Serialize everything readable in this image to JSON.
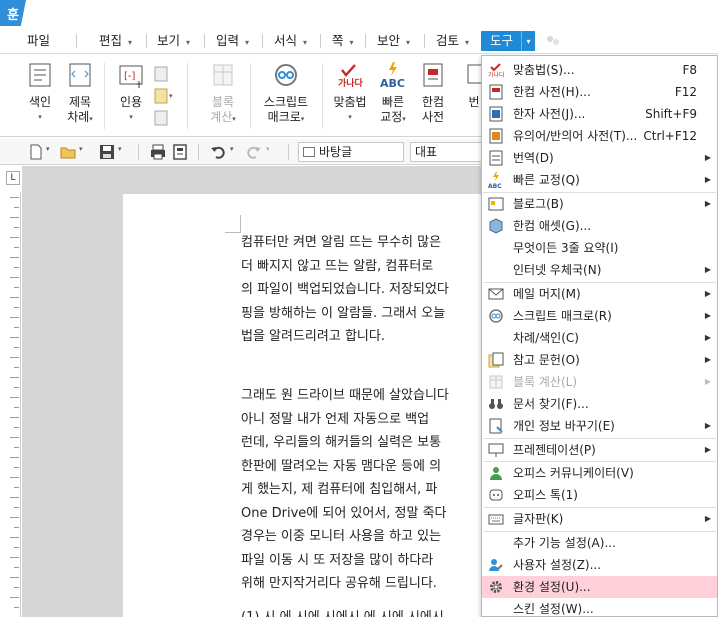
{
  "app": {
    "logo_glyph": "훈",
    "accent": "#1f8ad6"
  },
  "menubar": {
    "items": [
      {
        "label": "파일",
        "arrow": ""
      },
      {
        "label": "편집",
        "arrow": "▾"
      },
      {
        "label": "보기",
        "arrow": "▾"
      },
      {
        "label": "입력",
        "arrow": "▾"
      },
      {
        "label": "서식",
        "arrow": "▾"
      },
      {
        "label": "쪽",
        "arrow": "▾"
      },
      {
        "label": "보안",
        "arrow": "▾"
      },
      {
        "label": "검토",
        "arrow": "▾"
      }
    ],
    "active": {
      "label": "도구",
      "arrow": "▾"
    }
  },
  "ribbon": {
    "index": {
      "l1": "색인",
      "dd": "▾"
    },
    "toc": {
      "l1": "제목",
      "l2": "차례",
      "dd": "▾"
    },
    "cite": {
      "l1": "인용",
      "dd": "▾"
    },
    "blockcalc": {
      "l1": "블록",
      "l2": "계산",
      "dd": "▾"
    },
    "script": {
      "l1": "스크립트",
      "l2": "매크로",
      "dd": "▾"
    },
    "spell": {
      "l1": "맞춤법",
      "dd": "▾",
      "icon_text": "가나다"
    },
    "quick": {
      "l1": "빠른",
      "l2": "교정",
      "dd": "▾",
      "icon_text": "ABC"
    },
    "dict": {
      "l1": "한컴",
      "l2": "사전"
    },
    "cut": {
      "l1": "번"
    }
  },
  "toolbar": {
    "style_value": "바탕글",
    "para_value": "대표"
  },
  "ruler": {
    "corner": "L"
  },
  "document": {
    "para1": [
      "컴퓨터만 켜면 알림 뜨는 무수히 많은",
      "더 빠지지 않고 뜨는 알람, 컴퓨터로",
      "의 파일이 백업되었습니다. 저장되었다",
      "핑을 방해하는 이 알람들. 그래서 오늘",
      "법을 알려드리려고 합니다."
    ],
    "para2": [
      "그래도 원 드라이브 때문에 살았습니다",
      "아니 정말 내가 언제 자동으로 백업",
      "런데, 우리들의 해커들의 실력은 보통",
      "한판에 딸려오는 자동 맴다운 등에 의",
      "게 했는지, 제 컴퓨터에 침입해서, 파",
      "One Drive에 되어 있어서, 정말 죽다",
      "경우는 이중 모니터 사용을 하고 있는",
      "파일 이동 시 또 저장을 많이 하다라",
      "위해 만지작거리다 공유해 드립니다."
    ],
    "para3": "(1) 시    에 시에 시에시   에 시에 시에시"
  },
  "dropdown": {
    "items": [
      {
        "label": "맞춤법(S)...",
        "shortcut": "F8",
        "sub": "",
        "icon": "spellcheck-icon"
      },
      {
        "label": "한컴 사전(H)...",
        "shortcut": "F12",
        "sub": "",
        "icon": "dictionary-icon"
      },
      {
        "label": "한자 사전(J)...",
        "shortcut": "Shift+F9",
        "sub": "",
        "icon": "hanja-dictionary-icon"
      },
      {
        "label": "유의어/반의어 사전(T)...",
        "shortcut": "Ctrl+F12",
        "sub": "",
        "icon": "thesaurus-icon"
      },
      {
        "label": "번역(D)",
        "shortcut": "",
        "sub": "▶",
        "icon": "translate-icon"
      },
      {
        "label": "빠른 교정(Q)",
        "shortcut": "",
        "sub": "▶",
        "icon": "quick-correct-icon"
      },
      {
        "label": "블로그(B)",
        "shortcut": "",
        "sub": "▶",
        "icon": "blog-icon"
      },
      {
        "label": "한컴 애셋(G)...",
        "shortcut": "",
        "sub": "",
        "icon": "asset-icon"
      },
      {
        "label": "무엇이든 3줄 요약(I)",
        "shortcut": "",
        "sub": "",
        "icon": ""
      },
      {
        "label": "인터넷 우체국(N)",
        "shortcut": "",
        "sub": "▶",
        "icon": ""
      },
      {
        "label": "메일 머지(M)",
        "shortcut": "",
        "sub": "▶",
        "icon": "mail-merge-icon"
      },
      {
        "label": "스크립트 매크로(R)",
        "shortcut": "",
        "sub": "▶",
        "icon": "script-macro-icon"
      },
      {
        "label": "차례/색인(C)",
        "shortcut": "",
        "sub": "▶",
        "icon": ""
      },
      {
        "label": "참고 문헌(O)",
        "shortcut": "",
        "sub": "▶",
        "icon": "reference-icon"
      },
      {
        "label": "블록 계산(L)",
        "shortcut": "",
        "sub": "▶",
        "icon": "block-calc-icon",
        "disabled": true
      },
      {
        "label": "문서 찾기(F)...",
        "shortcut": "",
        "sub": "",
        "icon": "binoculars-icon"
      },
      {
        "label": "개인 정보 바꾸기(E)",
        "shortcut": "",
        "sub": "▶",
        "icon": "privacy-icon"
      },
      {
        "label": "프레젠테이션(P)",
        "shortcut": "",
        "sub": "▶",
        "icon": "presentation-icon"
      },
      {
        "label": "오피스 커뮤니케이터(V)",
        "shortcut": "",
        "sub": "",
        "icon": "communicator-icon"
      },
      {
        "label": "오피스 톡(1)",
        "shortcut": "",
        "sub": "",
        "icon": "office-talk-icon"
      },
      {
        "label": "글자판(K)",
        "shortcut": "",
        "sub": "▶",
        "icon": "keyboard-icon"
      },
      {
        "label": "추가 기능 설정(A)...",
        "shortcut": "",
        "sub": "",
        "icon": ""
      },
      {
        "label": "사용자 설정(Z)...",
        "shortcut": "",
        "sub": "",
        "icon": "user-settings-icon"
      },
      {
        "label": "환경 설정(U)...",
        "shortcut": "",
        "sub": "",
        "icon": "gear-icon",
        "highlighted": true
      },
      {
        "label": "스킨 설정(W)...",
        "shortcut": "",
        "sub": "",
        "icon": ""
      }
    ]
  }
}
